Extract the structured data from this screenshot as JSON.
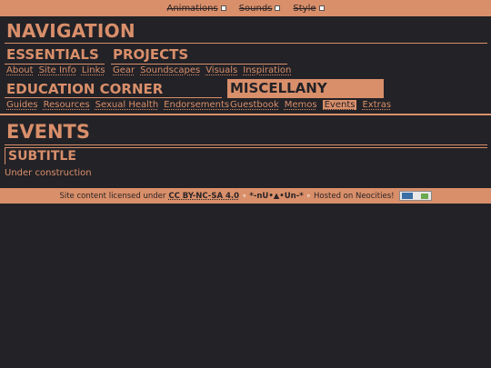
{
  "topbar": {
    "toggles": [
      {
        "label": "Animations"
      },
      {
        "label": "Sounds"
      },
      {
        "label": "Style"
      }
    ]
  },
  "nav": {
    "title": "NAVIGATION",
    "essentials": {
      "title": "ESSENTIALS",
      "links": [
        "About",
        "Site Info",
        "Links"
      ]
    },
    "projects": {
      "title": "PROJECTS",
      "links": [
        "Gear",
        "Soundscapes",
        "Visuals",
        "Inspiration"
      ]
    },
    "education": {
      "title": "EDUCATION CORNER",
      "links": [
        "Guides",
        "Resources",
        "Sexual Health",
        "Endorsements"
      ]
    },
    "misc": {
      "title": "MISCELLANY",
      "links": [
        "Guestbook",
        "Memos",
        "Events",
        "Extras"
      ],
      "active": "Events"
    }
  },
  "main": {
    "title": "EVENTS",
    "subtitle": "SUBTITLE",
    "text": "Under construction"
  },
  "footer": {
    "prefix": "Site content licensed under",
    "license": "CC BY-NC-SA 4.0",
    "sep1": "∘",
    "name": "*-nU•▲•Un-*",
    "sep2": "∘",
    "hosted": "Hosted on Neocities!"
  },
  "colors": {
    "background": "#232227",
    "accent": "#d98f6a"
  }
}
